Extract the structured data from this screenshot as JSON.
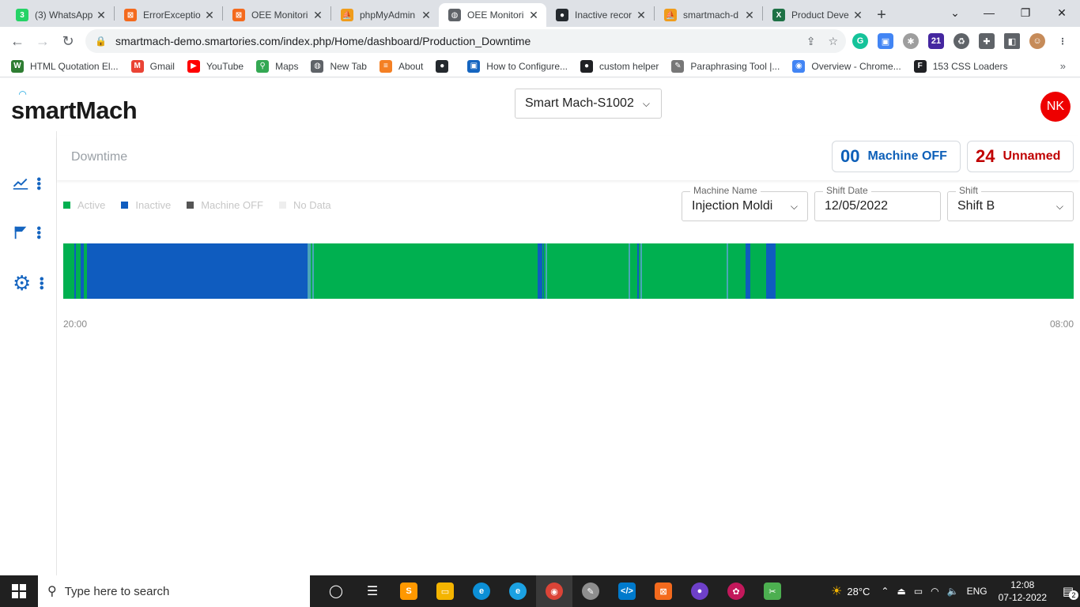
{
  "browser": {
    "tabs": [
      {
        "title": "(3) WhatsApp",
        "icon": "whatsapp-icon",
        "color": "#25d366",
        "glyph": "3"
      },
      {
        "title": "ErrorExceptio",
        "icon": "xampp-icon",
        "color": "#f46a1d",
        "glyph": "⊠"
      },
      {
        "title": "OEE Monitori",
        "icon": "xampp-icon",
        "color": "#f46a1d",
        "glyph": "⊠"
      },
      {
        "title": "phpMyAdmin",
        "icon": "phpmyadmin-icon",
        "color": "#f09c1b",
        "glyph": "⛵"
      },
      {
        "title": "OEE Monitori",
        "icon": "globe-icon",
        "color": "#5f6368",
        "glyph": "◍",
        "active": true
      },
      {
        "title": "Inactive recor",
        "icon": "github-icon",
        "color": "#24292e",
        "glyph": "●"
      },
      {
        "title": "smartmach-d",
        "icon": "phpmyadmin-icon",
        "color": "#f09c1b",
        "glyph": "⛵"
      },
      {
        "title": "Product Deve",
        "icon": "excel-icon",
        "color": "#1e7145",
        "glyph": "X"
      }
    ],
    "url": "smartmach-demo.smartories.com/index.php/Home/dashboard/Production_Downtime",
    "bookmarks": [
      {
        "label": "HTML Quotation El...",
        "icon": "w3-icon",
        "color": "#2e7d32",
        "glyph": "W"
      },
      {
        "label": "Gmail",
        "icon": "gmail-icon",
        "color": "#ea4335",
        "glyph": "M"
      },
      {
        "label": "YouTube",
        "icon": "youtube-icon",
        "color": "#ff0000",
        "glyph": "▶"
      },
      {
        "label": "Maps",
        "icon": "maps-icon",
        "color": "#34a853",
        "glyph": "⚲"
      },
      {
        "label": "New Tab",
        "icon": "globe-icon",
        "color": "#5f6368",
        "glyph": "◍"
      },
      {
        "label": "About",
        "icon": "stackoverflow-icon",
        "color": "#f48024",
        "glyph": "≡"
      },
      {
        "label": "",
        "icon": "github-icon",
        "color": "#24292e",
        "glyph": "●"
      },
      {
        "label": "How to Configure...",
        "icon": "bookmark-page-icon",
        "color": "#1565c0",
        "glyph": "▣"
      },
      {
        "label": "custom helper",
        "icon": "helper-icon",
        "color": "#202124",
        "glyph": "●"
      },
      {
        "label": "Paraphrasing Tool |...",
        "icon": "quill-icon",
        "color": "#777777",
        "glyph": "✎"
      },
      {
        "label": "Overview - Chrome...",
        "icon": "chrome-icon",
        "color": "#4285f4",
        "glyph": "◉"
      },
      {
        "label": "153 CSS Loaders",
        "icon": "css-icon",
        "color": "#202124",
        "glyph": "F"
      }
    ]
  },
  "app": {
    "logo_text": "smartMach",
    "machine_selector": "Smart Mach-S1002",
    "user_initials": "NK",
    "page_title": "Downtime",
    "stats": [
      {
        "value": "00",
        "label": "Machine OFF",
        "color": "#0d5fb8"
      },
      {
        "value": "24",
        "label": "Unnamed",
        "color": "#c00000"
      }
    ],
    "legend": [
      {
        "label": "Active",
        "color": "#00b050"
      },
      {
        "label": "Inactive",
        "color": "#0f5cbf"
      },
      {
        "label": "Machine OFF",
        "color": "#555555"
      },
      {
        "label": "No Data",
        "color": "#eeeeee"
      }
    ],
    "filters": {
      "machine_name_label": "Machine Name",
      "machine_name": "Injection Moldi",
      "shift_date_label": "Shift Date",
      "shift_date": "12/05/2022",
      "shift_label": "Shift",
      "shift": "Shift B"
    },
    "timeline": {
      "start_label": "20:00",
      "end_label": "08:00",
      "segments": [
        {
          "start": 0.0106,
          "end": 0.0122,
          "state": "inactive"
        },
        {
          "start": 0.0172,
          "end": 0.0203,
          "state": "inactive"
        },
        {
          "start": 0.0235,
          "end": 0.242,
          "state": "inactive"
        },
        {
          "start": 0.242,
          "end": 0.245,
          "state": "transition"
        },
        {
          "start": 0.2468,
          "end": 0.2482,
          "state": "transition"
        },
        {
          "start": 0.4695,
          "end": 0.4741,
          "state": "inactive"
        },
        {
          "start": 0.4749,
          "end": 0.4757,
          "state": "inactive"
        },
        {
          "start": 0.4773,
          "end": 0.4789,
          "state": "transition"
        },
        {
          "start": 0.5594,
          "end": 0.561,
          "state": "transition"
        },
        {
          "start": 0.5681,
          "end": 0.5696,
          "state": "inactive"
        },
        {
          "start": 0.5712,
          "end": 0.5728,
          "state": "transition"
        },
        {
          "start": 0.6565,
          "end": 0.6581,
          "state": "transition"
        },
        {
          "start": 0.6753,
          "end": 0.68,
          "state": "inactive"
        },
        {
          "start": 0.6956,
          "end": 0.705,
          "state": "inactive"
        }
      ]
    }
  },
  "taskbar": {
    "search_placeholder": "Type here to search",
    "weather": "28°C",
    "language": "ENG",
    "time": "12:08",
    "date": "07-12-2022",
    "notifications": "2"
  }
}
